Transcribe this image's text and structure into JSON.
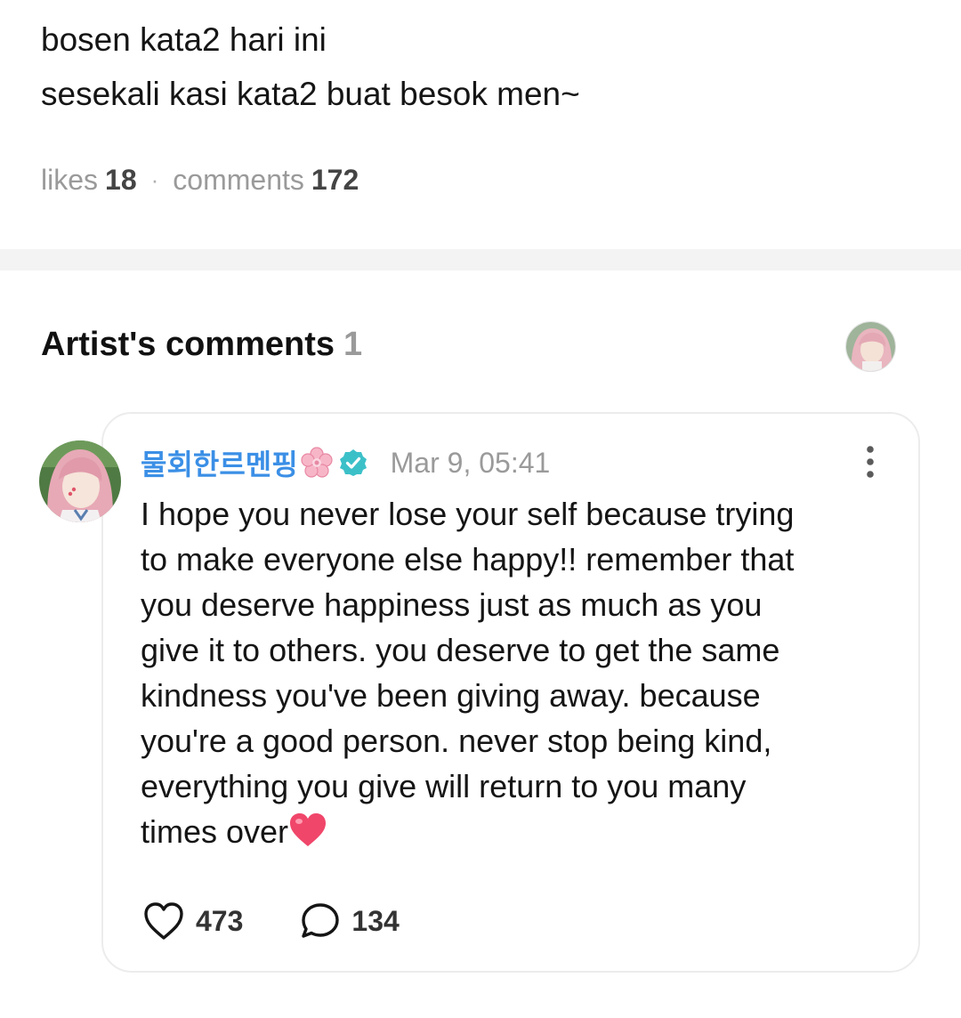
{
  "post": {
    "lines": [
      "bosen kata2 hari ini",
      "sesekali kasi kata2 buat besok men~"
    ],
    "likes_label": "likes",
    "likes_count": "18",
    "separator_dot": "·",
    "comments_label": "comments",
    "comments_count": "172"
  },
  "artist_comments": {
    "title": "Artist's comments",
    "count": "1"
  },
  "comment": {
    "author": "물회한르멘핑",
    "author_emoji": "cherry-blossom-icon",
    "verified_icon": "verified-badge-icon",
    "timestamp": "Mar 9, 05:41",
    "body": "I hope you never lose your self because trying to make everyone else happy!! remember that you deserve happiness just as much as you give it to others. you deserve to get the same kindness you've been giving away. because you're a good person. never stop being kind, everything you give will return to you many times over",
    "body_lines": [
      "I hope you never lose your self because trying",
      "to make everyone else happy!! remember that",
      "you deserve happiness just as much as you",
      "give it to others. you deserve to get the same",
      "kindness you've been giving away. because",
      "you're a good person. never stop being kind,",
      "everything you give will return to you many",
      "times over"
    ],
    "trailing_emoji": "red-heart-icon",
    "like_count": "473",
    "reply_count": "134"
  },
  "colors": {
    "author_blue": "#3b8fe6",
    "verified_teal": "#3cc0c8",
    "muted_gray": "#9a9a9a",
    "separator_gray": "#f3f3f3",
    "heart_pink": "#f0466a"
  }
}
